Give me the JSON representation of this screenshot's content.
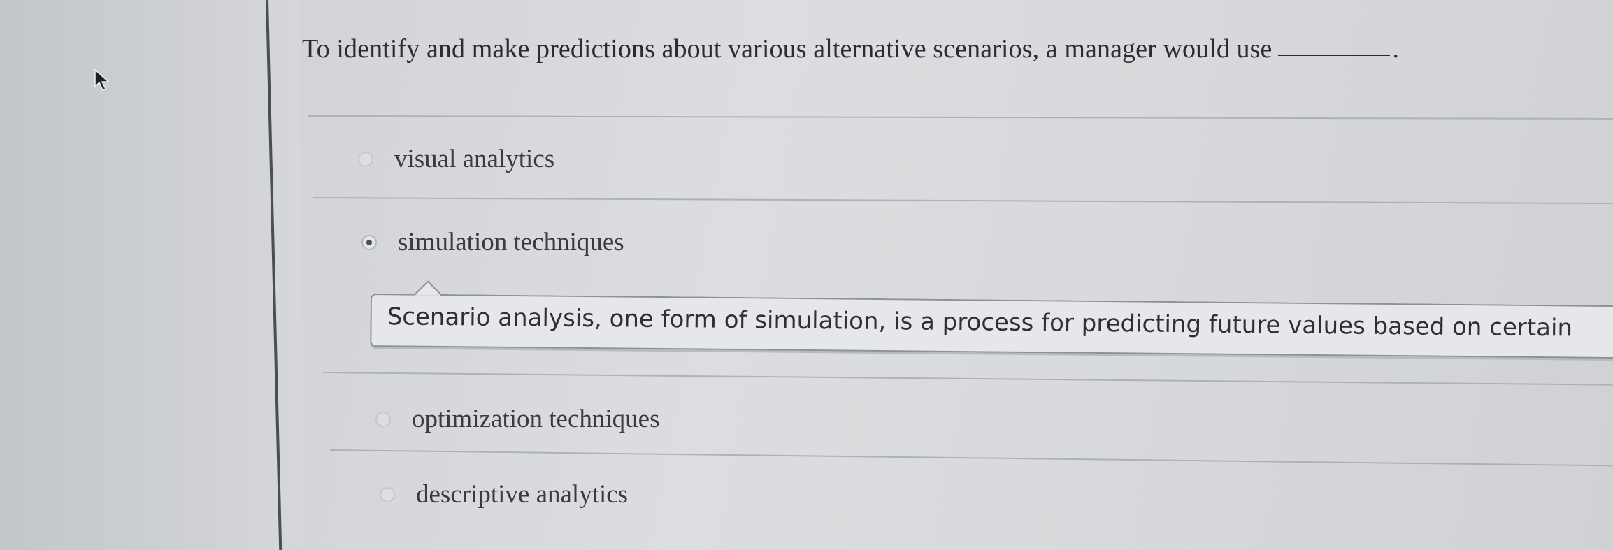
{
  "question": {
    "text": "To identify and make predictions about various alternative scenarios, a manager would use",
    "end_punct": "."
  },
  "options": [
    {
      "label": "visual analytics",
      "selected": false
    },
    {
      "label": "simulation techniques",
      "selected": true
    },
    {
      "label": "optimization techniques",
      "selected": false
    },
    {
      "label": "descriptive analytics",
      "selected": false
    }
  ],
  "feedback": {
    "text": "Scenario analysis, one form of simulation, is a process for predicting future values based on certain"
  },
  "icons": {
    "cursor": "mouse-pointer-icon",
    "radio": "radio-button-icon"
  },
  "colors": {
    "text": "#2b2c30",
    "feedback_bg": "#e6e7ea",
    "feedback_border": "#8e9196"
  }
}
